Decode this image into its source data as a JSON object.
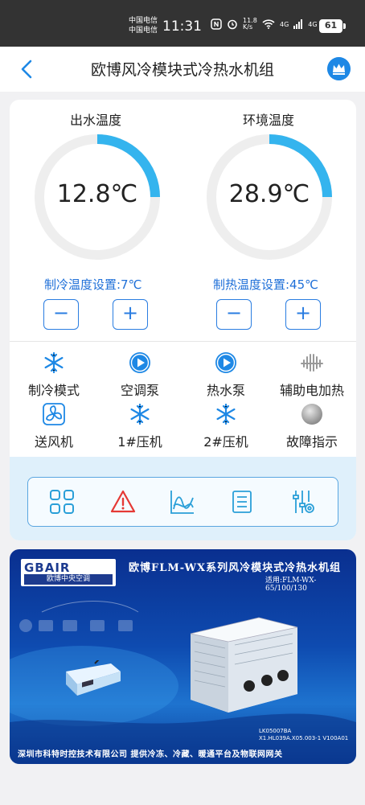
{
  "status_bar": {
    "carrier_1": "中国电信",
    "carrier_2": "中国电信",
    "time": "11:31",
    "net_speed": "11.8 K/s",
    "signal_1": "4G",
    "signal_2": "4G",
    "battery": "61"
  },
  "header": {
    "title": "欧博风冷模块式冷热水机组",
    "back_icon": "chevron-left-icon",
    "crown_icon": "crown-icon"
  },
  "gauges": [
    {
      "label": "出水温度",
      "value": "12.8℃",
      "fill_fraction": 0.25,
      "setpoint": "制冷温度设置:7℃",
      "minus": "−",
      "plus": "+"
    },
    {
      "label": "环境温度",
      "value": "28.9℃",
      "fill_fraction": 0.25,
      "setpoint": "制热温度设置:45℃",
      "minus": "−",
      "plus": "+"
    }
  ],
  "status_items": [
    {
      "label": "制冷模式",
      "icon": "snowflake-icon"
    },
    {
      "label": "空调泵",
      "icon": "play-circle-icon"
    },
    {
      "label": "热水泵",
      "icon": "play-circle-icon"
    },
    {
      "label": "辅助电加热",
      "icon": "heater-icon"
    },
    {
      "label": "送风机",
      "icon": "fan-icon"
    },
    {
      "label": "1#压机",
      "icon": "snowflake-icon"
    },
    {
      "label": "2#压机",
      "icon": "snowflake-icon"
    },
    {
      "label": "故障指示",
      "icon": "indicator-light-icon"
    }
  ],
  "toolbar": [
    {
      "icon": "grid-icon"
    },
    {
      "icon": "warning-icon"
    },
    {
      "icon": "chart-icon"
    },
    {
      "icon": "list-icon"
    },
    {
      "icon": "settings-sliders-icon"
    }
  ],
  "banner": {
    "logo_top": "GBAIR",
    "logo_bottom": "欧博中央空调",
    "title": "欧博FLM-WX系列风冷模块式冷热水机组",
    "subtitle": "适用:FLM-WX-65/100/130",
    "model_line_1": "LK05007BA",
    "model_line_2": "X1.HL039A.X05.003-1 V100A01",
    "footer": "深圳市科特时控技术有限公司   提供冷冻、冷藏、暖通平台及物联网网关"
  },
  "colors": {
    "accent": "#1e88e5",
    "gauge_arc": "#34b4ee",
    "gauge_track": "#eeeeee",
    "warning": "#e53935"
  }
}
